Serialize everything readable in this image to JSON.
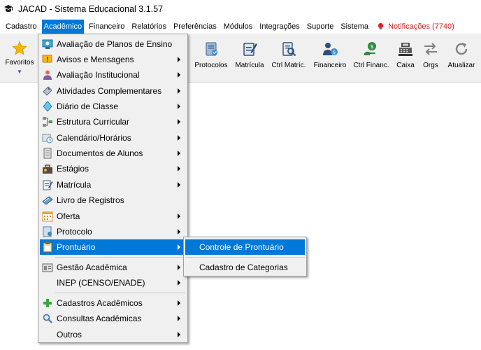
{
  "window": {
    "title": "JACAD - Sistema Educacional 3.1.57"
  },
  "menubar": {
    "items": [
      {
        "label": "Cadastro"
      },
      {
        "label": "Acadêmico"
      },
      {
        "label": "Financeiro"
      },
      {
        "label": "Relatórios"
      },
      {
        "label": "Preferências"
      },
      {
        "label": "Módulos"
      },
      {
        "label": "Integrações"
      },
      {
        "label": "Suporte"
      },
      {
        "label": "Sistema"
      }
    ],
    "notifications": "Notificações (7740)",
    "active_index": 1
  },
  "toolbar": {
    "favoritos": "Favoritos",
    "buttons": [
      {
        "label": "Protocolos",
        "icon": "protocol-icon"
      },
      {
        "label": "Matrícula",
        "icon": "enrollment-icon"
      },
      {
        "label": "Ctrl Matríc.",
        "icon": "enrollment-control-icon"
      },
      {
        "label": "Financeiro",
        "icon": "finance-icon"
      },
      {
        "label": "Ctrl Financ.",
        "icon": "finance-control-icon"
      },
      {
        "label": "Caixa",
        "icon": "cash-register-icon"
      },
      {
        "label": "Orgs",
        "icon": "swap-arrows-icon"
      },
      {
        "label": "Atualizar",
        "icon": "refresh-icon"
      }
    ]
  },
  "academico_menu": {
    "items": [
      {
        "label": "Avaliação de Planos de Ensino",
        "icon": "teaching-plan-icon",
        "submenu": false
      },
      {
        "label": "Avisos e Mensagens",
        "icon": "warning-message-icon",
        "submenu": true
      },
      {
        "label": "Avaliação Institucional",
        "icon": "institutional-evaluation-icon",
        "submenu": true
      },
      {
        "label": "Atividades Complementares",
        "icon": "activities-icon",
        "submenu": true
      },
      {
        "label": "Diário de Classe",
        "icon": "class-diary-icon",
        "submenu": true
      },
      {
        "label": "Estrutura Curricular",
        "icon": "curriculum-structure-icon",
        "submenu": true
      },
      {
        "label": "Calendário/Horários",
        "icon": "calendar-schedule-icon",
        "submenu": true
      },
      {
        "label": "Documentos de Alunos",
        "icon": "student-documents-icon",
        "submenu": true
      },
      {
        "label": "Estágios",
        "icon": "internship-icon",
        "submenu": true
      },
      {
        "label": "Matrícula",
        "icon": "enrollment-icon",
        "submenu": true
      },
      {
        "label": "Livro de Registros",
        "icon": "record-book-icon",
        "submenu": false
      },
      {
        "label": "Oferta",
        "icon": "offer-calendar-icon",
        "submenu": true
      },
      {
        "label": "Protocolo",
        "icon": "protocol-icon",
        "submenu": true
      },
      {
        "label": "Prontuário",
        "icon": "clipboard-icon",
        "submenu": true
      },
      {
        "label": "Gestão Acadêmica",
        "icon": "academic-management-icon",
        "submenu": true
      },
      {
        "label": "INEP (CENSO/ENADE)",
        "icon": "",
        "submenu": true
      },
      {
        "label": "Cadastros Acadêmicos",
        "icon": "plus-icon",
        "submenu": true
      },
      {
        "label": "Consultas Acadêmicas",
        "icon": "magnifier-icon",
        "submenu": true
      },
      {
        "label": "Outros",
        "icon": "",
        "submenu": true
      }
    ],
    "selected_index": 13
  },
  "prontuario_submenu": {
    "items": [
      {
        "label": "Controle de Prontuário"
      },
      {
        "label": "Cadastro de Categorias"
      }
    ],
    "selected_index": 0
  },
  "colors": {
    "accent": "#0078d7",
    "notification": "#d01f1f",
    "toolbar_bg": "#f0f0f0"
  }
}
